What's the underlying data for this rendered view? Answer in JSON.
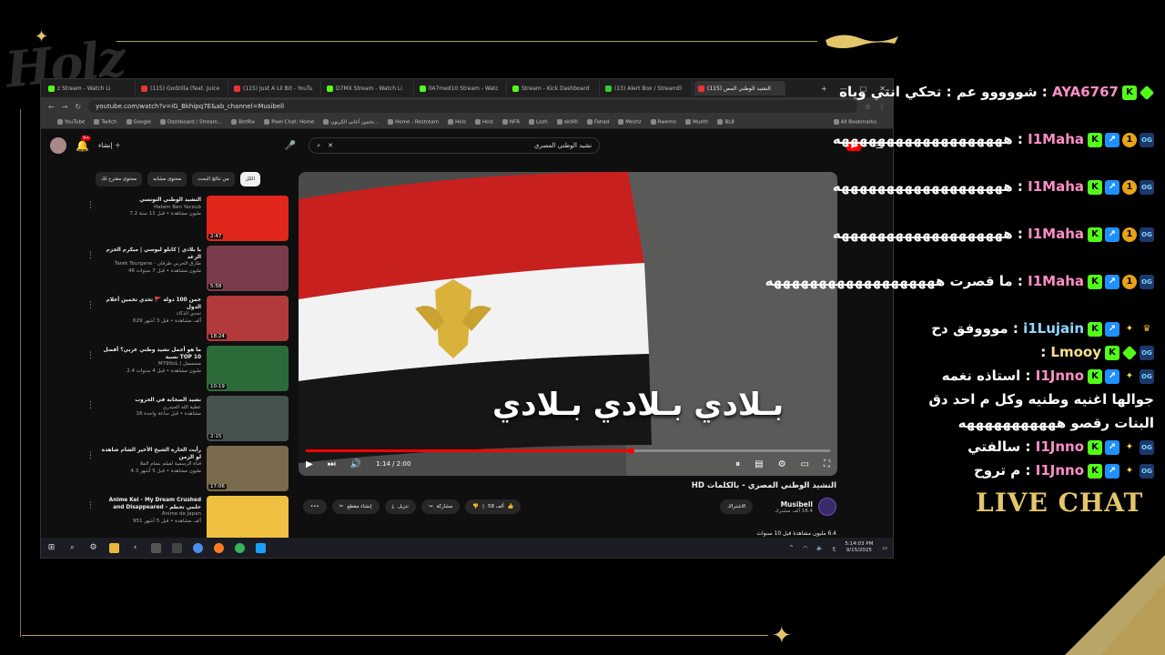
{
  "overlay": {
    "logo": "Holz",
    "live_chat": "LIVE CHAT",
    "accent": "#e4c66a"
  },
  "browser": {
    "tabs": [
      "z Stream - Watch Li",
      "(115) Godzilla (feat. Juice",
      "(115) Just A Lil Bit - YouTu",
      "D7MX Stream - Watch Li",
      "llA7med10 Stream - Watc",
      "Stream - Kick Dashboard",
      "(13) Alert Box / StreamEl",
      "(115) النشيد الوطني المص"
    ],
    "url": "youtube.com/watch?v=iG_Bkhipq7E&ab_channel=Musibell",
    "bookmarks": [
      "YouTube",
      "Twitch",
      "Google",
      "Dashboard / Stream...",
      "BotRix",
      "Pixel Chat: Home",
      "تخمين أغاني الكرتون...",
      "Home - Restream",
      "Holz",
      "Holz",
      "NFR",
      "Lozh",
      "ak90l",
      "Fahad",
      "Meshz",
      "Rwemn",
      "Mueth",
      "BL8",
      "All Bookmarks"
    ]
  },
  "youtube": {
    "search_query": "نشيد الوطني المصري",
    "create_label": "إنشاء",
    "notif_count": "9+",
    "chips": [
      "الكل",
      "من نتائج البحث",
      "محتوى مشابه",
      "محتوى مقترح لك"
    ],
    "recommendations": [
      {
        "title": "النشيد الوطني التونسي",
        "channel": "Hatem Ben Yacoub",
        "meta": "7.2 مليون مشاهدة • قبل 11 سنة",
        "duration": "2:47"
      },
      {
        "title": "يا بلادي | كابلو لبوسي | مبكرم الحزم الرعد",
        "channel": "Tarek Tourgane - طارق الحربي طرقان",
        "meta": "46 مليون مشاهدة • قبل 7 سنوات",
        "duration": "5:58"
      },
      {
        "title": "خمن 100 دولة 🚩 تحدي تخمين أعلام الدول",
        "channel": "تحدي الذكاء",
        "meta": "629 ألف مشاهدة • قبل 3 أشهر",
        "duration": "18:24"
      },
      {
        "title": "ما هو أجمل نشيد وطني عربي؟ أفضل نسبة TOP 10",
        "channel": "M790oL | مسمسل",
        "meta": "2.4 مليون مشاهدة • قبل 4 سنوات",
        "duration": "10:19"
      },
      {
        "title": "نشيد الصحابة في الحروب",
        "channel": "عطية الله الحيدري",
        "meta": "16 مشاهدة • قبل ساعة واحدة",
        "duration": "2:15"
      },
      {
        "title": "رأيت الحارة الشيخ الأخير الشام شاهدة لو الزمن",
        "channel": "قناة الرسمية لفيلم بسام الملا",
        "meta": "4.3 مليون مشاهدة • قبل 5 أشهر",
        "duration": "17:06"
      },
      {
        "title": "Anime Kei - My Dream Crushed and Disappeared - حلمي تحطم",
        "channel": "Anime de Japan",
        "meta": "951 ألف مشاهدة • قبل 5 أشهر",
        "duration": ""
      }
    ],
    "lyrics": "بـلادي بـلادي بـلادي",
    "time": "1:14 / 2:00",
    "progress": 0.62,
    "video_title": "النشيد الوطني المصري - بالكلمات HD",
    "channel": "Musibell",
    "subs": "18.4 ألف مشترك",
    "subscribe": "الاشتراك",
    "likes": "58 ألف",
    "share": "مشاركة",
    "download": "تنزيل",
    "clip": "إنشاء مقطع",
    "views": "6.4 مليون مشاهدة  قبل 10 سنوات"
  },
  "taskbar": {
    "time": "5:14:03 PM",
    "date": "9/15/2025",
    "lang": "ع"
  },
  "chat": [
    {
      "user": "AYA6767",
      "text": "شووووو عم : تحكي انتي وياه",
      "badges": [
        "kick",
        "diamond"
      ]
    },
    {
      "user": "I1Maha",
      "text": "هههههههههههههههههههه",
      "badges": [
        "kick",
        "blue",
        "gold",
        "og"
      ]
    },
    {
      "user": "I1Maha",
      "text": "هههههههههههههههههههه",
      "badges": [
        "kick",
        "blue",
        "gold",
        "og"
      ]
    },
    {
      "user": "I1Maha",
      "text": "هههههههههههههههههههه",
      "badges": [
        "kick",
        "blue",
        "gold",
        "og"
      ]
    },
    {
      "user": "I1Maha",
      "text": "ما قصرت هههههههههههههههههههه",
      "badges": [
        "kick",
        "blue",
        "gold",
        "og"
      ]
    },
    {
      "user": "i1Lujain",
      "text": "موووفق دح",
      "badges": [
        "kick",
        "blue",
        "wing",
        "crown"
      ]
    },
    {
      "user": "Lmooy",
      "text": "",
      "badges": [
        "kick",
        "diamond",
        "og"
      ]
    },
    {
      "user": "I1Jnno",
      "text": "استاذه نغمه جوالها اغنيه وطنيه وكل م احد دق البنات رقصو هههههههههههه",
      "badges": [
        "kick",
        "blue",
        "wing",
        "og"
      ]
    },
    {
      "user": "I1Jnno",
      "text": "سالفتي",
      "badges": [
        "kick",
        "blue",
        "wing",
        "og"
      ]
    },
    {
      "user": "I1Jnno",
      "text": "م تروح",
      "badges": [
        "kick",
        "blue",
        "wing",
        "og"
      ]
    }
  ]
}
